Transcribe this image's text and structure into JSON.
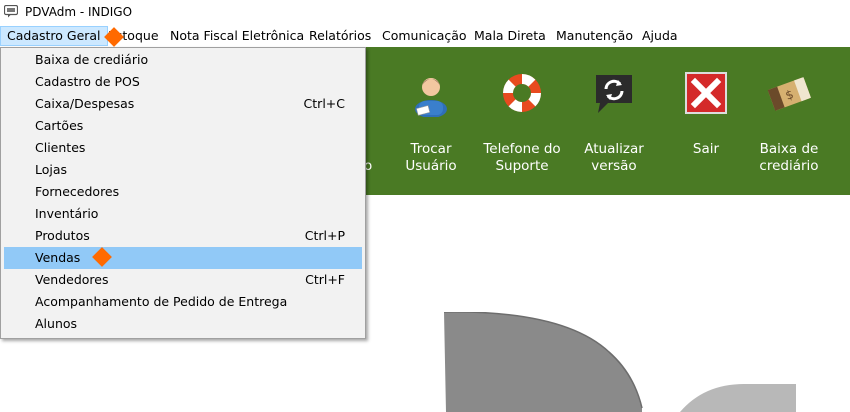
{
  "window": {
    "title": "PDVAdm - INDIGO"
  },
  "menubar": {
    "items": [
      {
        "label": "Cadastro Geral",
        "open": true
      },
      {
        "label": "Estoque"
      },
      {
        "label": "Nota Fiscal Eletrônica"
      },
      {
        "label": "Relatórios"
      },
      {
        "label": "Comunicação"
      },
      {
        "label": "Mala Direta"
      },
      {
        "label": "Manutenção"
      },
      {
        "label": "Ajuda"
      }
    ]
  },
  "dropdown": {
    "items": [
      {
        "label": "Baixa de crediário",
        "shortcut": ""
      },
      {
        "label": "Cadastro de POS",
        "shortcut": ""
      },
      {
        "label": "Caixa/Despesas",
        "shortcut": "Ctrl+C"
      },
      {
        "label": "Cartões",
        "shortcut": ""
      },
      {
        "label": "Clientes",
        "shortcut": ""
      },
      {
        "label": "Lojas",
        "shortcut": ""
      },
      {
        "label": "Fornecedores",
        "shortcut": ""
      },
      {
        "label": "Inventário",
        "shortcut": ""
      },
      {
        "label": "Produtos",
        "shortcut": "Ctrl+P"
      },
      {
        "label": "Vendas",
        "shortcut": "",
        "highlighted": true
      },
      {
        "label": "Vendedores",
        "shortcut": "Ctrl+F"
      },
      {
        "label": "Acompanhamento de Pedido de Entrega",
        "shortcut": ""
      },
      {
        "label": "Alunos",
        "shortcut": ""
      }
    ]
  },
  "toolbar": {
    "partial_label": "o",
    "buttons": [
      {
        "line1": "Trocar",
        "line2": "Usuário",
        "icon": "user-icon"
      },
      {
        "line1": "Telefone do",
        "line2": "Suporte",
        "icon": "lifebuoy-icon"
      },
      {
        "line1": "Atualizar",
        "line2": "versão",
        "icon": "refresh-chat-icon"
      },
      {
        "line1": "Sair",
        "line2": "",
        "icon": "exit-icon"
      },
      {
        "line1": "Baixa de",
        "line2": "crediário",
        "icon": "money-ticket-icon"
      }
    ]
  },
  "colors": {
    "toolbar_bg": "#4a7a24",
    "menu_highlight": "#91c9f7",
    "cursor_marker": "#ff6a00"
  }
}
